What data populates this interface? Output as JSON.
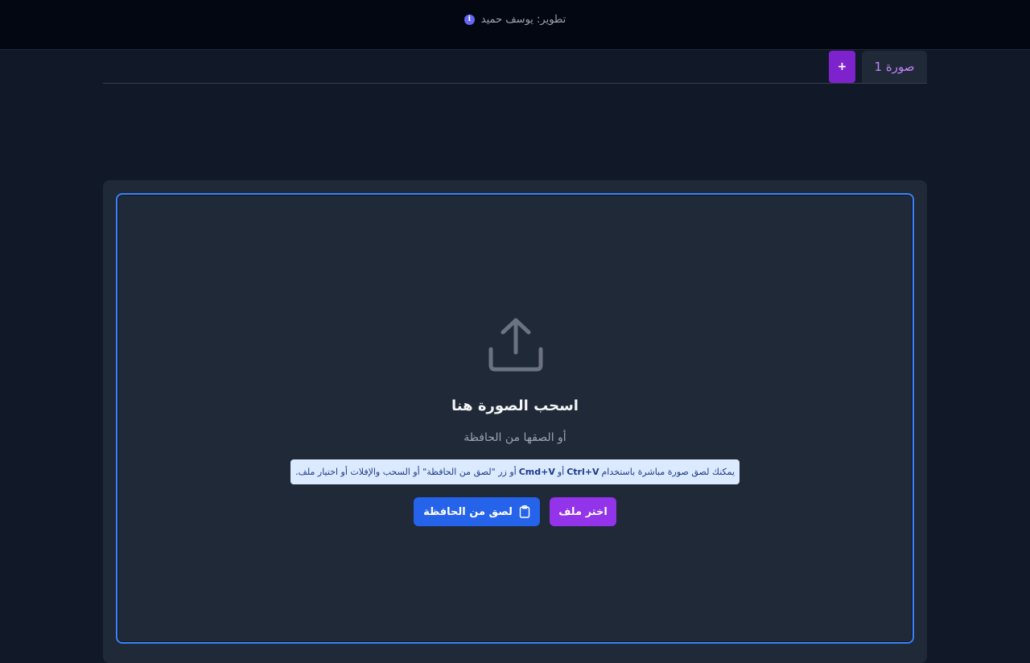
{
  "header": {
    "credit": "تطوير: يوسف حميد",
    "info_icon": "i"
  },
  "tabs": {
    "items": [
      {
        "label": "صورة 1"
      }
    ],
    "add_label": "+"
  },
  "dropzone": {
    "icon": "upload-icon",
    "title": "اسحب الصورة هنا",
    "subtitle": "أو الصقها من الحافظة",
    "hint": {
      "part1": "يمكنك لصق صورة مباشرة باستخدام",
      "key1": "Ctrl+V",
      "part2": "أو",
      "key2": "Cmd+V",
      "part3": "أو زر \"لصق من الحافظة\" أو السحب والإفلات أو اختيار ملف."
    },
    "choose_file_label": "اختر ملف",
    "paste_label": "لصق من الحافظة"
  },
  "colors": {
    "accent_purple": "#9333ea",
    "accent_blue": "#2563eb",
    "border_blue": "#3b82f6"
  }
}
